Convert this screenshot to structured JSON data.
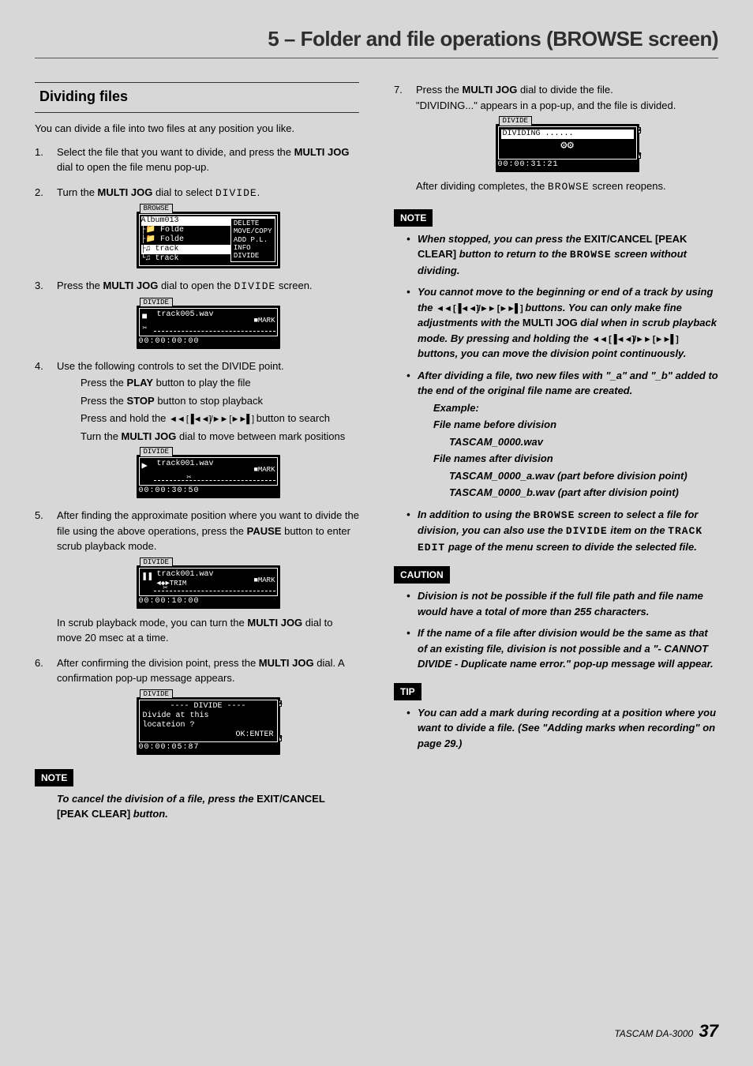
{
  "chapter_title": "5 – Folder and file operations (BROWSE screen)",
  "section_heading": "Dividing files",
  "intro": "You can divide a file into two files at any position you like.",
  "steps": {
    "s1a": "Select the file that you want to divide, and press the ",
    "s1b": "MULTI JOG",
    "s1c": " dial to open the file menu pop-up.",
    "s2a": "Turn the ",
    "s2b": "MULTI JOG",
    "s2c": " dial to select ",
    "s2d": "DIVIDE",
    "s2e": ".",
    "s3a": "Press the ",
    "s3b": "MULTI JOG",
    "s3c": " dial to open the ",
    "s3d": "DIVIDE",
    "s3e": " screen.",
    "s4": "Use the following controls to set the DIVIDE point.",
    "s4_p1a": "Press the ",
    "s4_p1b": "PLAY",
    "s4_p1c": " button to play the file",
    "s4_p2a": "Press the ",
    "s4_p2b": "STOP",
    "s4_p2c": " button to stop playback",
    "s4_p3a": "Press and hold the ",
    "s4_p3b": " button to search",
    "s4_p4a": "Turn the ",
    "s4_p4b": "MULTI JOG",
    "s4_p4c": " dial to move between mark positions",
    "s5a": "After finding the approximate position where you want to divide the file using the above operations, press the ",
    "s5b": "PAUSE",
    "s5c": " button to enter scrub playback mode.",
    "s5_after_a": "In scrub playback mode, you can turn the ",
    "s5_after_b": "MULTI JOG",
    "s5_after_c": " dial to move 20 msec at a time.",
    "s6a": "After confirming the division point, press the ",
    "s6b": "MULTI JOG",
    "s6c": " dial. A confirmation pop-up message appears.",
    "s7a": "Press the ",
    "s7b": "MULTI JOG",
    "s7c": " dial to divide the file.",
    "s7d": "\"DIVIDING...\" appears in a pop-up, and the file is divided.",
    "s7_after_a": "After dividing completes, the ",
    "s7_after_b": "BROWSE",
    "s7_after_c": " screen reopens."
  },
  "lcds": {
    "browse": {
      "title": "BROWSE",
      "l1": "Album013",
      "l2": "├📁 Folde",
      "l3": "├📁 Folde",
      "l4": "├♫ track",
      "l5": "└♫ track",
      "menu": "DELETE\nMOVE/COPY\nADD P.L.\nINFO\nDIVIDE"
    },
    "div1": {
      "title": "DIVIDE",
      "fname": "track005.wav",
      "mark": "■MARK",
      "time": "00:00:00:00"
    },
    "div2": {
      "title": "DIVIDE",
      "fname": "track001.wav",
      "mark": "■MARK",
      "time": "00:00:30:50"
    },
    "div3": {
      "title": "DIVIDE",
      "fname": "track001.wav",
      "trim": "◄◆►TRIM",
      "mark": "■MARK",
      "time": "00:00:10:00"
    },
    "div4": {
      "title": "DIVIDE",
      "l1": "---- DIVIDE ----",
      "l2": "Divide at this",
      "l3": "locateion ?",
      "l4": "OK:ENTER",
      "time": "00:00:05:87"
    },
    "div5": {
      "title": "DIVIDE",
      "l1": "DIVIDING ......",
      "time": "00:00:31:21"
    }
  },
  "left_note": {
    "label": "NOTE",
    "t1": "To cancel the division of a file, press the ",
    "t2": "EXIT/CANCEL [PEAK CLEAR]",
    "t3": " button."
  },
  "right_note": {
    "label": "NOTE",
    "b1a": "When stopped, you can press the ",
    "b1b": "EXIT/CANCEL [PEAK CLEAR]",
    "b1c": " button to return to the ",
    "b1d": "BROWSE",
    "b1e": " screen without dividing.",
    "b2a": "You cannot move to the beginning or end of a track by using the ",
    "b2b": " buttons. You can only make fine adjustments with the ",
    "b2c": "MULTI JOG",
    "b2d": " dial when in scrub playback mode. By pressing and holding the ",
    "b2e": " buttons, you can move the division point continuously.",
    "b3": "After dividing a file, two new files with \"_a\" and \"_b\" added to the end of the original file name are created.",
    "b3_ex": "Example:",
    "b3_bef": "File name before division",
    "b3_bef_v": "TASCAM_0000.wav",
    "b3_aft": "File names after division",
    "b3_aft_v1": "TASCAM_0000_a.wav (part before division point)",
    "b3_aft_v2": "TASCAM_0000_b.wav (part after division point)",
    "b4a": "In addition to using the ",
    "b4b": "BROWSE",
    "b4c": " screen to select a file for division, you can also use the ",
    "b4d": "DIVIDE",
    "b4e": " item on the ",
    "b4f": "TRACK EDIT",
    "b4g": " page of the menu screen to divide the selected file."
  },
  "caution": {
    "label": "CAUTION",
    "b1": "Division is not be possible if the full file path and file name would have a total of more than 255 characters.",
    "b2": "If the name of a file after division would be the same as that of an existing file, division is not possible and a \"- CANNOT DIVIDE - Duplicate name error.\" pop-up message will appear."
  },
  "tip": {
    "label": "TIP",
    "b1": "You can add a mark during recording at a position where you want to divide a file. (See \"Adding marks when recording\" on page 29.)"
  },
  "transport_buttons": "◄◄ [▐◄◄]/►► [►►▌]",
  "footer_model": "TASCAM DA-3000",
  "footer_page": "37"
}
